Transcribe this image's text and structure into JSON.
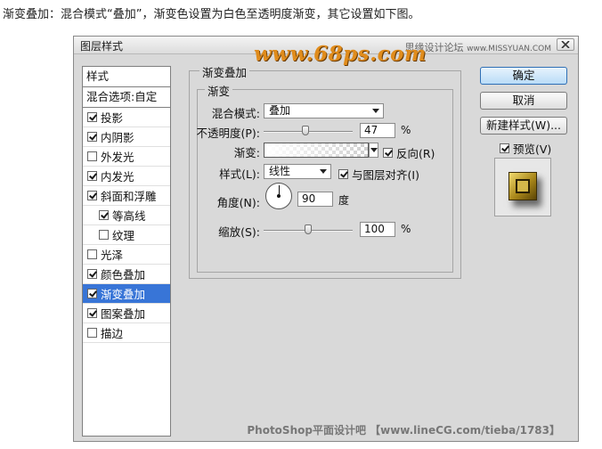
{
  "caption": "渐变叠加：混合模式“叠加”，渐变色设置为白色至透明度渐变，其它设置如下图。",
  "dialog": {
    "title": "图层样式",
    "watermark_top": "www.68ps.com",
    "watermark_right_cn": "思缘设计论坛",
    "watermark_right_en": "www.MISSYUAN.COM",
    "watermark_bottom": "PhotoShop平面设计吧 【www.lineCG.com/tieba/1783】"
  },
  "left_panel": {
    "header": "样式",
    "blend_options": "混合选项:自定",
    "items": [
      {
        "label": "投影",
        "checked": true,
        "sub": false,
        "selected": false
      },
      {
        "label": "内阴影",
        "checked": true,
        "sub": false,
        "selected": false
      },
      {
        "label": "外发光",
        "checked": false,
        "sub": false,
        "selected": false
      },
      {
        "label": "内发光",
        "checked": true,
        "sub": false,
        "selected": false
      },
      {
        "label": "斜面和浮雕",
        "checked": true,
        "sub": false,
        "selected": false
      },
      {
        "label": "等高线",
        "checked": true,
        "sub": true,
        "selected": false
      },
      {
        "label": "纹理",
        "checked": false,
        "sub": true,
        "selected": false
      },
      {
        "label": "光泽",
        "checked": false,
        "sub": false,
        "selected": false
      },
      {
        "label": "颜色叠加",
        "checked": true,
        "sub": false,
        "selected": false
      },
      {
        "label": "渐变叠加",
        "checked": true,
        "sub": false,
        "selected": true
      },
      {
        "label": "图案叠加",
        "checked": true,
        "sub": false,
        "selected": false
      },
      {
        "label": "描边",
        "checked": false,
        "sub": false,
        "selected": false
      }
    ]
  },
  "gradient_overlay": {
    "section_title": "渐变叠加",
    "group_title": "渐变",
    "blend_mode_label": "混合模式:",
    "blend_mode_value": "叠加",
    "opacity_label": "不透明度(P):",
    "opacity_value": "47",
    "opacity_level": 0.47,
    "percent_sign": "%",
    "gradient_label": "渐变:",
    "reverse_label": "反向(R)",
    "reverse_checked": true,
    "style_label": "样式(L):",
    "style_value": "线性",
    "align_label": "与图层对齐(I)",
    "align_checked": true,
    "angle_label": "角度(N):",
    "angle_value": "90",
    "angle_unit": "度",
    "scale_label": "缩放(S):",
    "scale_value": "100",
    "scale_level": 0.5
  },
  "right_panel": {
    "ok_label": "确定",
    "cancel_label": "取消",
    "new_style_label": "新建样式(W)...",
    "preview_label": "预览(V)",
    "preview_checked": true
  }
}
